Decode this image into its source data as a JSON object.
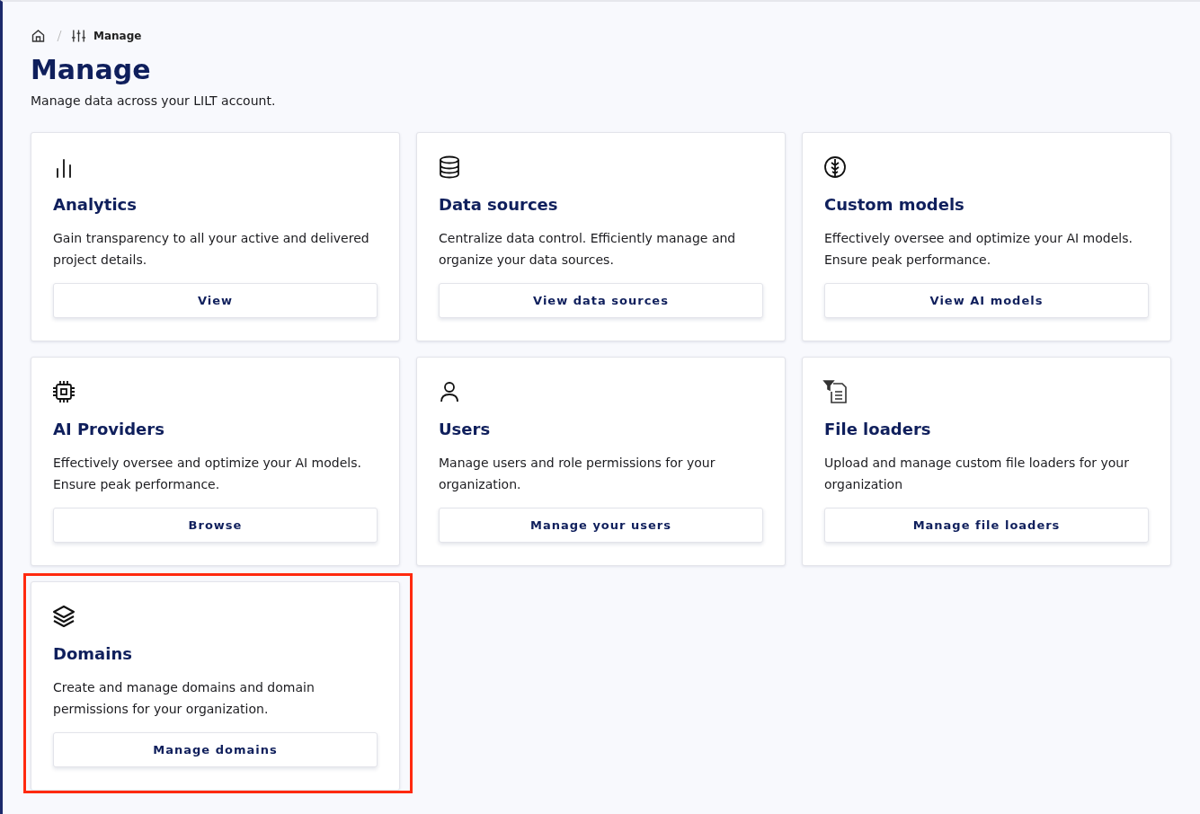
{
  "breadcrumb": {
    "current": "Manage"
  },
  "header": {
    "title": "Manage",
    "subtitle": "Manage data across your LILT account."
  },
  "cards": [
    {
      "kind": "bars",
      "title": "Analytics",
      "description": "Gain transparency to all your active and delivered project details.",
      "button": "View",
      "highlighted": false
    },
    {
      "kind": "database",
      "title": "Data sources",
      "description": "Centralize data control. Efficiently manage and organize your data sources.",
      "button": "View data sources",
      "highlighted": false
    },
    {
      "kind": "brain",
      "title": "Custom models",
      "description": "Effectively oversee and optimize your AI models. Ensure peak performance.",
      "button": "View AI models",
      "highlighted": false
    },
    {
      "kind": "chip",
      "title": "AI Providers",
      "description": "Effectively oversee and optimize your AI models. Ensure peak performance.",
      "button": "Browse",
      "highlighted": false
    },
    {
      "kind": "user",
      "title": "Users",
      "description": "Manage users and role permissions for your organization.",
      "button": "Manage your users",
      "highlighted": false
    },
    {
      "kind": "fileloader",
      "title": "File loaders",
      "description": "Upload and manage custom file loaders for your organization",
      "button": "Manage file loaders",
      "highlighted": false
    },
    {
      "kind": "layers",
      "title": "Domains",
      "description": "Create and manage domains and domain permissions for your organization.",
      "button": "Manage domains",
      "highlighted": true
    }
  ]
}
